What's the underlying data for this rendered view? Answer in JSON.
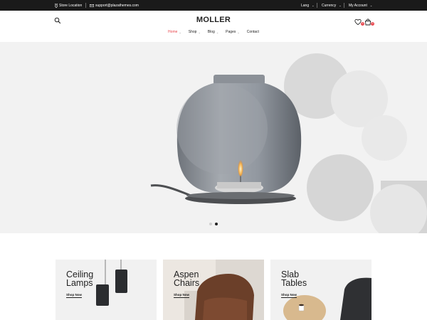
{
  "topbar": {
    "store_location": "Store Location",
    "email": "support@plazathemes.com",
    "lang": "Lang",
    "currency": "Currency",
    "account": "My Account"
  },
  "header": {
    "logo": "MOLLER",
    "wishlist_count": "0",
    "cart_count": "0"
  },
  "nav": {
    "items": [
      {
        "label": "Home",
        "active": true,
        "has_dropdown": true
      },
      {
        "label": "Shop",
        "has_dropdown": true
      },
      {
        "label": "Blog",
        "has_dropdown": true
      },
      {
        "label": "Pages",
        "has_dropdown": true
      },
      {
        "label": "Contact",
        "has_dropdown": false
      }
    ]
  },
  "hero": {
    "slide_count": 2,
    "active_slide": 2
  },
  "categories": [
    {
      "title": "Ceiling\nLamps",
      "link": "Shop Now"
    },
    {
      "title": "Aspen\nChairs",
      "link": "Shop Now"
    },
    {
      "title": "Slab\nTables",
      "link": "Shop Now"
    }
  ],
  "colors": {
    "accent": "#e8464d",
    "topbar_bg": "#1a1a1a",
    "hero_bg": "#f2f2f2"
  }
}
